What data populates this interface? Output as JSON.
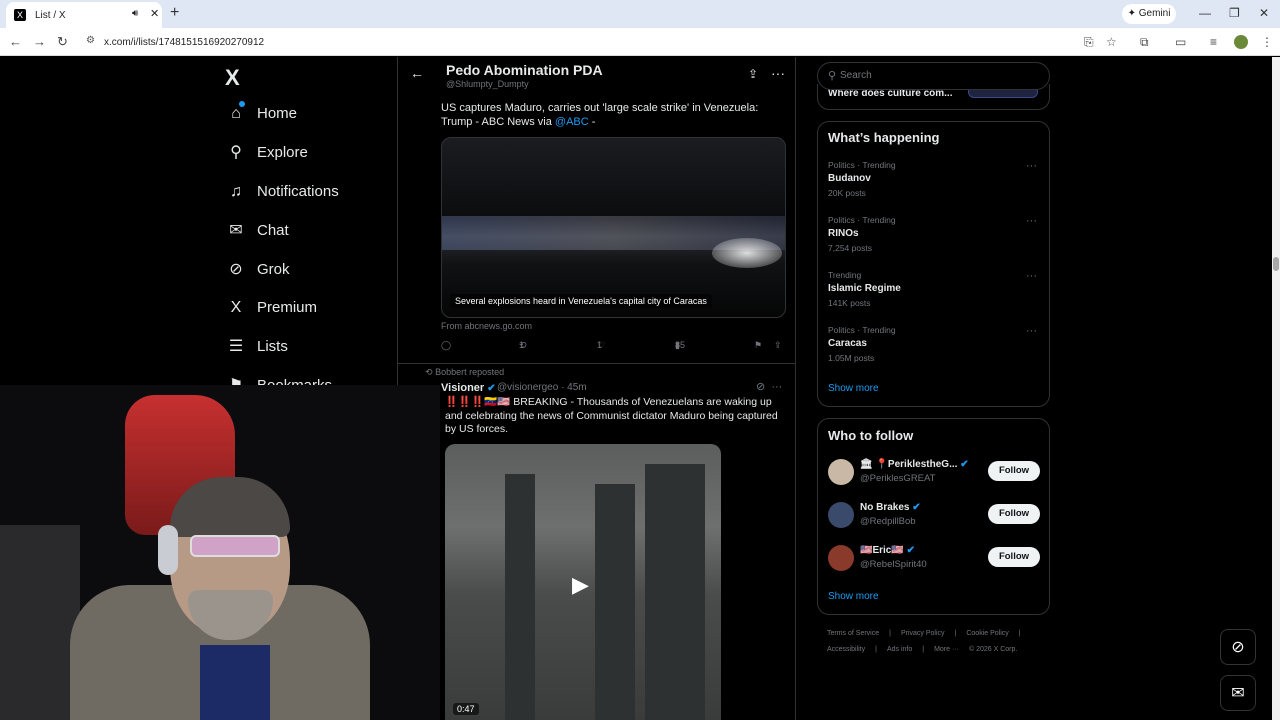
{
  "browser": {
    "tab_title": "List / X",
    "tab_favicon": "X",
    "new_tab": "+",
    "gemini_label": "Gemini",
    "url": "x.com/i/lists/1748151516920270912",
    "icons": [
      "back-icon",
      "forward-icon",
      "reload-icon",
      "install-icon",
      "star-icon",
      "extensions-icon",
      "sidepanel-icon",
      "media-icon",
      "profile-icon",
      "menu-icon"
    ]
  },
  "nav": {
    "logo": "X",
    "items": [
      {
        "label": "Home",
        "icon": "home-icon",
        "glyph": "⌂"
      },
      {
        "label": "Explore",
        "icon": "search-icon",
        "glyph": "⚲"
      },
      {
        "label": "Notifications",
        "icon": "bell-icon",
        "glyph": "🔔︎"
      },
      {
        "label": "Chat",
        "icon": "mail-icon",
        "glyph": "✉"
      },
      {
        "label": "Grok",
        "icon": "grok-icon",
        "glyph": "⊘"
      },
      {
        "label": "Premium",
        "icon": "x-icon",
        "glyph": "X"
      },
      {
        "label": "Lists",
        "icon": "list-icon",
        "glyph": "☰"
      },
      {
        "label": "Bookmarks",
        "icon": "bookmark-icon",
        "glyph": "⚑"
      }
    ]
  },
  "list_header": {
    "title": "Pedo Abomination PDA",
    "handle": "@Shlumpty_Dumpty"
  },
  "tweet1": {
    "text": "US captures Maduro, carries out 'large scale strike' in Venezuela: Trump - ABC News via",
    "mention": "@ABC",
    "suffix": " -",
    "card_caption": "Several explosions heard in Venezuela's capital city of Caracas",
    "card_source": "From abcnews.go.com",
    "reposts": "1",
    "likes": "1",
    "views": "85"
  },
  "tweet2": {
    "repost_note": "Bobbert reposted",
    "name": "Visioner",
    "handle": "@visionergeo",
    "time": "· 45m",
    "text": "‼️‼️‼️🇻🇪🇺🇸 BREAKING - Thousands of Venezuelans are waking up and celebrating the news of Communist dictator Maduro being captured by US forces.",
    "video_duration": "0:47"
  },
  "right": {
    "search_placeholder": "Search",
    "prev_card_text": "Where does culture com...",
    "whats_happening_title": "What’s happening",
    "trends": [
      {
        "category": "Politics · Trending",
        "name": "Budanov",
        "count": "20K posts"
      },
      {
        "category": "Politics · Trending",
        "name": "RINOs",
        "count": "7,254 posts"
      },
      {
        "category": "Trending",
        "name": "Islamic Regime",
        "count": "141K posts"
      },
      {
        "category": "Politics · Trending",
        "name": "Caracas",
        "count": "1.05M posts"
      }
    ],
    "show_more": "Show more",
    "who_to_follow_title": "Who to follow",
    "follow_suggestions": [
      {
        "name": "🏛 📍PeriklestheG...",
        "handle": "@PeriklesGREAT",
        "button": "Follow",
        "avatar_color": "#c9b8a6"
      },
      {
        "name": "No Brakes",
        "handle": "@RedpillBob",
        "button": "Follow",
        "avatar_color": "#3a4a6a"
      },
      {
        "name": "🇺🇸Eric🇺🇸",
        "handle": "@RebelSpirit40",
        "button": "Follow",
        "avatar_color": "#8a3a2a"
      }
    ],
    "footer_line1": [
      "Terms of Service",
      "|",
      "Privacy Policy",
      "|",
      "Cookie Policy",
      "|"
    ],
    "footer_line2": [
      "Accessibility",
      "|",
      "Ads info",
      "|",
      "More ···",
      "© 2026 X Corp."
    ]
  },
  "colors": {
    "accent": "#1d9bf0",
    "background": "#000000",
    "border": "#2f3336",
    "muted": "#71767b"
  }
}
